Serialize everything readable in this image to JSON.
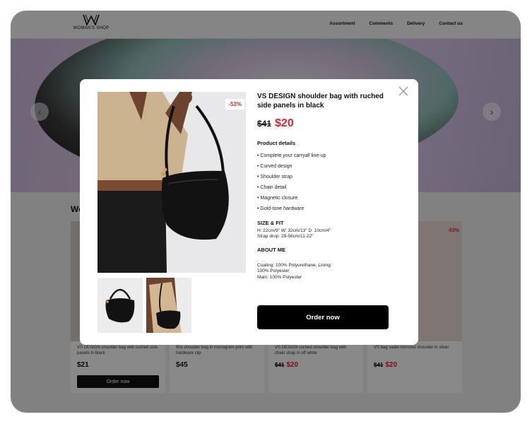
{
  "header": {
    "logo_text": "WOMAN'S SHOP",
    "nav": [
      "Assortment",
      "Comments",
      "Delivery",
      "Contact us"
    ]
  },
  "section": {
    "title": "Wo"
  },
  "cards": [
    {
      "name": "VS DESIGN shoulder bag with ruched side panels in black",
      "price": "$21",
      "old_price": "",
      "new_price": "",
      "button": "Order now",
      "discount": ""
    },
    {
      "name": "90s shoulder bag in monogram print with hardware clip",
      "price": "$45",
      "old_price": "",
      "new_price": "",
      "button": "",
      "discount": ""
    },
    {
      "name": "VS DESIGN ruched shoulder bag with chain strap in off white",
      "price": "",
      "old_price": "$41",
      "new_price": "$20",
      "button": "",
      "discount": ""
    },
    {
      "name": "VS bag sadie mirrored shoulder in silver",
      "price": "",
      "old_price": "$41",
      "new_price": "$20",
      "button": "",
      "discount": "-53%"
    }
  ],
  "modal": {
    "title": "VS DESIGN shoulder bag with ruched side panels in black",
    "old_price": "$41",
    "new_price": "$20",
    "badge": "-53%",
    "details_heading": "Product details",
    "details": [
      "• Complete your carryall line-up",
      "• Curved design",
      "• Shoulder strap",
      "• Chain detail",
      "• Magnetic closure",
      "• Gold-tone hardware"
    ],
    "size_heading": "SIZE & FIT",
    "size_line1": "H: 22cm/9\" W: 32cm/13\" D: 10cm/4\"",
    "size_line2": "Strap drop: 29-56cm/11-22\"",
    "about_heading": "ABOUT ME",
    "about_line1": "Coating: 100% Polyurethane, Lining:",
    "about_line2": "100% Polyester",
    "about_line3": "Main: 100% Polyester",
    "order_label": "Order now",
    "close_icon": "close-icon"
  },
  "colors": {
    "accent": "#e0222d",
    "dark": "#000000"
  }
}
